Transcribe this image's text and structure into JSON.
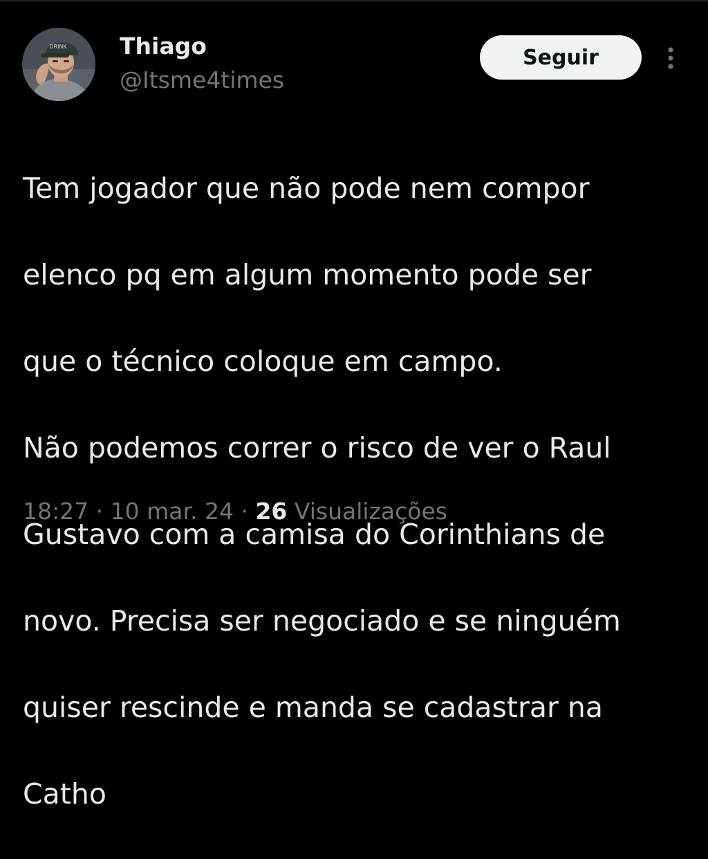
{
  "author": {
    "display_name": "Thiago",
    "handle": "@Itsme4times",
    "avatar_cap_text": "DRINK"
  },
  "actions": {
    "follow_label": "Seguir",
    "more_icon": "more-vertical-icon"
  },
  "tweet": {
    "text_lines": [
      "Tem jogador que não pode nem compor",
      "elenco pq em algum momento pode ser",
      "que o técnico coloque em campo.",
      "Não podemos correr o risco de ver o Raul",
      "Gustavo com a camisa do Corinthians de",
      "novo. Precisa ser negociado e se ninguém",
      "quiser rescinde e manda se cadastrar na",
      "Catho"
    ]
  },
  "meta": {
    "time": "18:27",
    "separator": "·",
    "date": "10 mar. 24",
    "views_count": "26",
    "views_label": "Visualizações"
  },
  "colors": {
    "background": "#000000",
    "primary_text": "#e7e9ea",
    "secondary_text": "#71767b",
    "button_bg": "#eff3f4",
    "button_text": "#0f1419"
  }
}
